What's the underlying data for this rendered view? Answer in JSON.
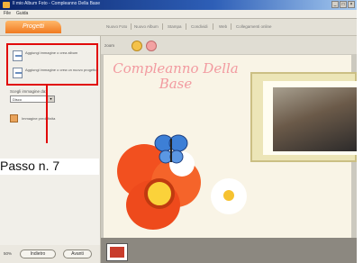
{
  "window": {
    "title": "Il mio Album Foto - Compleanno Della Base",
    "controls": [
      "_",
      "□",
      "×"
    ]
  },
  "menu": {
    "items": [
      "File",
      "Guida"
    ]
  },
  "nav": {
    "logo_label": "Progetti",
    "items": [
      "Nuovo Foto",
      "Nuovo Album",
      "Stampa",
      "Condividi",
      "Web",
      "Collegamenti online"
    ]
  },
  "sidebar": {
    "steps": [
      {
        "label": "Aggiungi immagine o crea album"
      },
      {
        "label": "Aggiungi immagine o crea un nuovo progetto"
      }
    ],
    "section_label": "Scegli immagine da:",
    "select_value": "Disco",
    "sub_item_label": "Immagine predefinita",
    "bottom_buttons": [
      "Indietro",
      "Avanti"
    ],
    "zoom_label": "50%"
  },
  "callout": {
    "text": "Passo n. 7"
  },
  "toolbar": {
    "label": "zoom"
  },
  "card": {
    "title": "Compleanno Della Base"
  },
  "icons": {
    "app": "app-icon",
    "step1": "image-icon",
    "step2": "check-image-icon",
    "sub": "folder-icon",
    "butterfly": "butterfly-icon"
  },
  "colors": {
    "accent_orange": "#f07a20",
    "callout_red": "#e10a0a",
    "title_pink": "#f29aa0"
  }
}
